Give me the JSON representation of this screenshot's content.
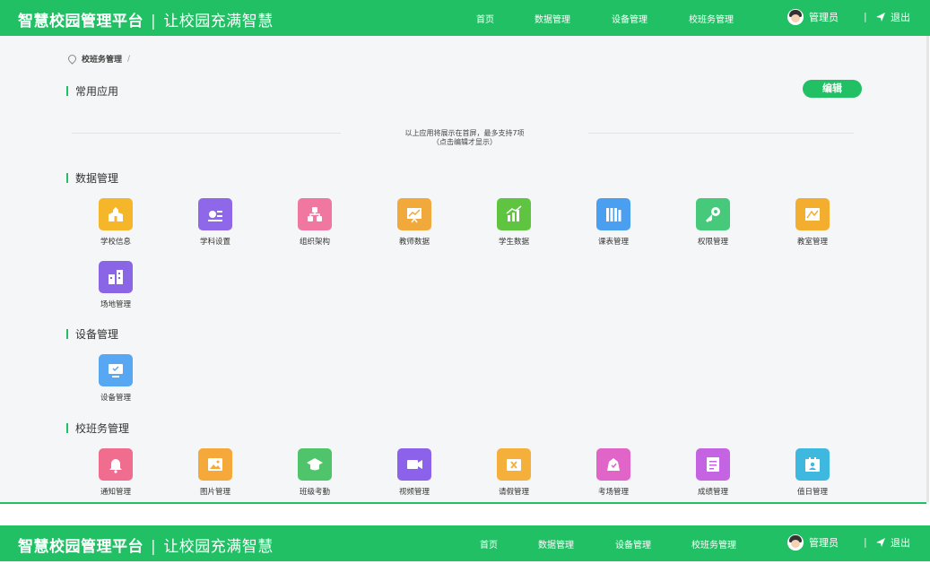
{
  "header": {
    "brand": "智慧校园管理平台",
    "separator": "|",
    "slogan": "让校园充满智慧",
    "nav": [
      "首页",
      "数据管理",
      "设备管理",
      "校班务管理"
    ],
    "user": "管理员",
    "divider": "|",
    "logout": "退出"
  },
  "breadcrumb": {
    "current": "校班务管理",
    "separator": "/"
  },
  "common_apps": {
    "title": "常用应用",
    "edit_label": "编辑",
    "hint_line1": "以上应用将展示在首屏，最多支持7项",
    "hint_line2": "（点击编辑才显示）"
  },
  "sections": {
    "data": {
      "title": "数据管理",
      "items": [
        {
          "label": "学校信息",
          "icon": "school-icon",
          "color": "#f5b62a"
        },
        {
          "label": "学科设置",
          "icon": "subject-settings-icon",
          "color": "#8f68ea"
        },
        {
          "label": "组织架构",
          "icon": "org-structure-icon",
          "color": "#f0779f"
        },
        {
          "label": "教师数据",
          "icon": "teacher-data-icon",
          "color": "#f2a93b"
        },
        {
          "label": "学生数据",
          "icon": "student-data-icon",
          "color": "#5fc540"
        },
        {
          "label": "课表管理",
          "icon": "timetable-icon",
          "color": "#4b9ff0"
        },
        {
          "label": "权限管理",
          "icon": "key-icon",
          "color": "#46c97a"
        },
        {
          "label": "教室管理",
          "icon": "classroom-icon",
          "color": "#f3ae30"
        },
        {
          "label": "场地管理",
          "icon": "venue-icon",
          "color": "#8a66e6"
        }
      ]
    },
    "device": {
      "title": "设备管理",
      "items": [
        {
          "label": "设备管理",
          "icon": "monitor-icon",
          "color": "#57a7f2"
        }
      ]
    },
    "class_affairs": {
      "title": "校班务管理",
      "items": [
        {
          "label": "通知管理",
          "icon": "bell-icon",
          "color": "#f16d8f"
        },
        {
          "label": "图片管理",
          "icon": "image-icon",
          "color": "#f4a93a"
        },
        {
          "label": "班级考勤",
          "icon": "graduation-cap-icon",
          "color": "#4fc46a"
        },
        {
          "label": "视频管理",
          "icon": "video-icon",
          "color": "#8c62ea"
        },
        {
          "label": "请假管理",
          "icon": "leave-icon",
          "color": "#f5b03b"
        },
        {
          "label": "考场管理",
          "icon": "exam-room-icon",
          "color": "#e164c8"
        },
        {
          "label": "成绩管理",
          "icon": "grades-icon",
          "color": "#c564e3"
        },
        {
          "label": "值日管理",
          "icon": "duty-icon",
          "color": "#3fb8e0"
        }
      ]
    }
  },
  "accent_color": "#22c065"
}
